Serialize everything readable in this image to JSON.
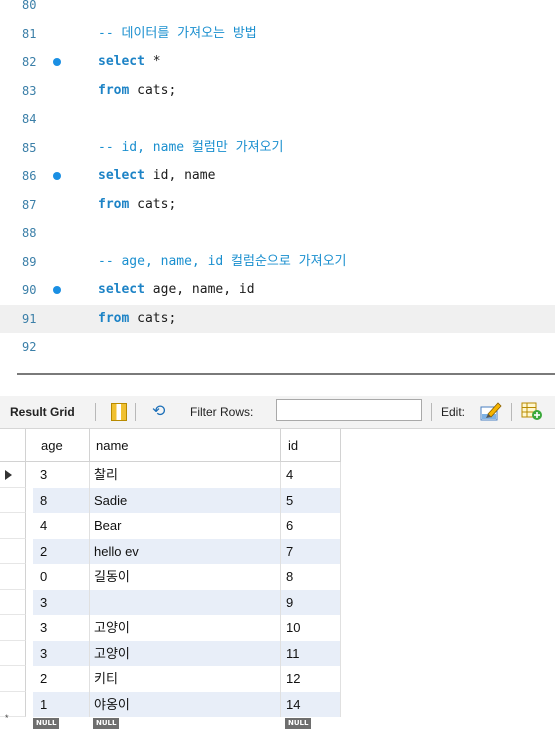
{
  "editor": {
    "lines": [
      {
        "num": "80",
        "dot": false,
        "parts": []
      },
      {
        "num": "81",
        "dot": false,
        "parts": [
          {
            "t": "-- 데이터를 가져오는 방법",
            "c": "cm"
          }
        ]
      },
      {
        "num": "82",
        "dot": true,
        "parts": [
          {
            "t": "select",
            "c": "kw"
          },
          {
            "t": " *",
            "c": ""
          }
        ]
      },
      {
        "num": "83",
        "dot": false,
        "parts": [
          {
            "t": "from",
            "c": "kw"
          },
          {
            "t": " cats;",
            "c": ""
          }
        ]
      },
      {
        "num": "84",
        "dot": false,
        "parts": []
      },
      {
        "num": "85",
        "dot": false,
        "parts": [
          {
            "t": "-- id, name 컬럼만 가져오기",
            "c": "cm"
          }
        ]
      },
      {
        "num": "86",
        "dot": true,
        "parts": [
          {
            "t": "select",
            "c": "kw"
          },
          {
            "t": " id, name",
            "c": ""
          }
        ]
      },
      {
        "num": "87",
        "dot": false,
        "parts": [
          {
            "t": "from",
            "c": "kw"
          },
          {
            "t": " cats;",
            "c": ""
          }
        ]
      },
      {
        "num": "88",
        "dot": false,
        "parts": []
      },
      {
        "num": "89",
        "dot": false,
        "parts": [
          {
            "t": "-- age, name, id 컬럼순으로 가져오기",
            "c": "cm"
          }
        ]
      },
      {
        "num": "90",
        "dot": true,
        "parts": [
          {
            "t": "select",
            "c": "kw"
          },
          {
            "t": " age, name, id",
            "c": ""
          }
        ]
      },
      {
        "num": "91",
        "dot": false,
        "current": true,
        "parts": [
          {
            "t": "from",
            "c": "kw"
          },
          {
            "t": " cats;",
            "c": ""
          }
        ]
      },
      {
        "num": "92",
        "dot": false,
        "parts": []
      }
    ]
  },
  "toolbar": {
    "title": "Result Grid",
    "filter_label": "Filter Rows:",
    "filter_value": "",
    "edit_label": "Edit:"
  },
  "grid": {
    "columns": [
      "age",
      "name",
      "id"
    ],
    "rows": [
      [
        "3",
        "찰리",
        "4"
      ],
      [
        "8",
        "Sadie",
        "5"
      ],
      [
        "4",
        "Bear",
        "6"
      ],
      [
        "2",
        "hello ev",
        "7"
      ],
      [
        "0",
        "길동이",
        "8"
      ],
      [
        "3",
        "",
        "9"
      ],
      [
        "3",
        "고양이",
        "10"
      ],
      [
        "3",
        "고양이",
        "11"
      ],
      [
        "2",
        "키티",
        "12"
      ],
      [
        "1",
        "야옹이",
        "14"
      ]
    ],
    "selected_row": 0,
    "null_label": "NULL"
  },
  "colors": {
    "keyword": "#1d83c6",
    "comment": "#1a8fcf",
    "line_number": "#3b7fa8",
    "breakpoint": "#1a8fe3",
    "alt_row": "#e8eef8"
  }
}
